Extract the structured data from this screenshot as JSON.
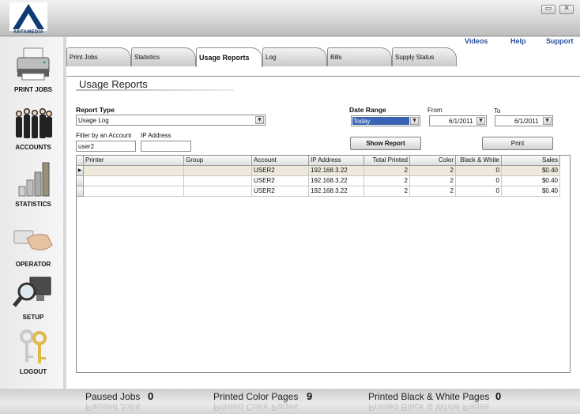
{
  "app": {
    "logo_text": "ANTAMEDIA",
    "window_buttons": {
      "minimize": "▭",
      "close": "✕"
    }
  },
  "sidebar": {
    "items": [
      {
        "label": "PRINT JOBS",
        "icon": "printer-icon"
      },
      {
        "label": "ACCOUNTS",
        "icon": "people-icon"
      },
      {
        "label": "STATISTICS",
        "icon": "bar-chart-icon"
      },
      {
        "label": "OPERATOR",
        "icon": "hand-card-icon"
      },
      {
        "label": "SETUP",
        "icon": "magnifier-monitor-icon"
      },
      {
        "label": "LOGOUT",
        "icon": "keys-icon"
      }
    ]
  },
  "top_links": {
    "videos": "Videos",
    "help": "Help",
    "support": "Support"
  },
  "tabs": [
    {
      "label": "Print Jobs"
    },
    {
      "label": "Statistics"
    },
    {
      "label": "Usage Reports"
    },
    {
      "label": "Log"
    },
    {
      "label": "Bills"
    },
    {
      "label": "Supply Status"
    }
  ],
  "page": {
    "title": "Usage Reports",
    "report_type_label": "Report Type",
    "report_type_value": "Usage Log",
    "filter_account_label": "Filter by an Account",
    "filter_account_value": "user2",
    "ip_address_label": "IP Address",
    "ip_address_value": "",
    "date_range_label": "Date Range",
    "date_range_value": "Today",
    "from_label": "From",
    "from_value": "6/1/2011",
    "to_label": "To",
    "to_value": "6/1/2011",
    "show_report_label": "Show Report",
    "print_label": "Print"
  },
  "grid": {
    "columns": [
      "Printer",
      "Group",
      "Account",
      "IP Address",
      "Total Printed",
      "Color",
      "Black & White",
      "Sales"
    ],
    "rows": [
      [
        "",
        "",
        "USER2",
        "192.168.3.22",
        "2",
        "2",
        "0",
        "$0.40"
      ],
      [
        "",
        "",
        "USER2",
        "192.168.3.22",
        "2",
        "2",
        "0",
        "$0.40"
      ],
      [
        "",
        "",
        "USER2",
        "192.168.3.22",
        "2",
        "2",
        "0",
        "$0.40"
      ]
    ],
    "selected_row": 0,
    "row_marker": "▶"
  },
  "status": {
    "paused_label": "Paused Jobs",
    "paused_value": "0",
    "color_label": "Printed Color Pages",
    "color_value": "9",
    "bw_label": "Printed Black & White Pages",
    "bw_value": "0"
  },
  "colors": {
    "accent_link": "#2a4f9c",
    "selection": "#3a63b4",
    "logo_blue": "#0f3a73"
  }
}
